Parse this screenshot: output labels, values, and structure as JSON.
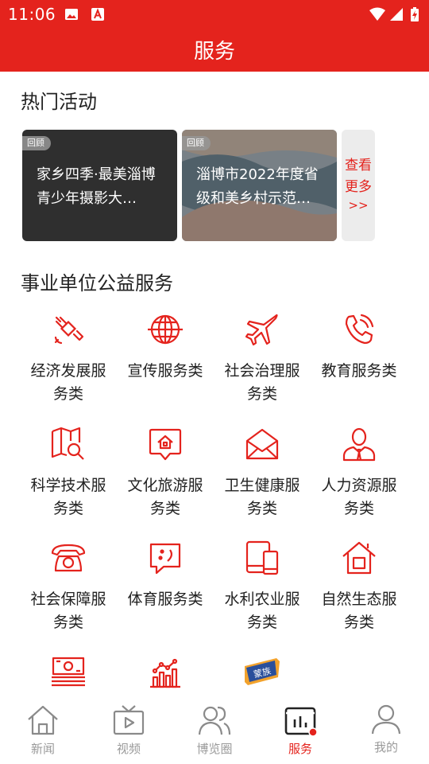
{
  "status_bar": {
    "time": "11:06",
    "icons": [
      "image-icon",
      "a-badge-icon",
      "wifi-icon",
      "signal-icon",
      "battery-icon"
    ]
  },
  "header": {
    "title": "服务"
  },
  "hot_activities": {
    "title": "热门活动",
    "cards": [
      {
        "badge": "回顾",
        "text": "家乡四季·最美淄博青少年摄影大…"
      },
      {
        "badge": "回顾",
        "text": "淄博市2022年度省级和美乡村示范…"
      }
    ],
    "more": {
      "line1": "查看",
      "line2": "更多",
      "line3": ">>"
    }
  },
  "public_services": {
    "title": "事业单位公益服务",
    "items": [
      {
        "label": "经济发展服务类",
        "icon": "satellite-icon"
      },
      {
        "label": "宣传服务类",
        "icon": "globe-icon"
      },
      {
        "label": "社会治理服务类",
        "icon": "airplane-icon"
      },
      {
        "label": "教育服务类",
        "icon": "phone-call-icon"
      },
      {
        "label": "科学技术服务类",
        "icon": "map-search-icon"
      },
      {
        "label": "文化旅游服务类",
        "icon": "home-bubble-icon"
      },
      {
        "label": "卫生健康服务类",
        "icon": "envelope-icon"
      },
      {
        "label": "人力资源服务类",
        "icon": "person-icon"
      },
      {
        "label": "社会保障服务类",
        "icon": "telephone-icon"
      },
      {
        "label": "体育服务类",
        "icon": "chat-bubble-icon"
      },
      {
        "label": "水利农业服务类",
        "icon": "devices-icon"
      },
      {
        "label": "自然生态服务类",
        "icon": "house-icon"
      },
      {
        "label": "",
        "icon": "money-stack-icon"
      },
      {
        "label": "",
        "icon": "bar-chart-icon"
      },
      {
        "label": "",
        "icon": "ribbon-tag-icon",
        "tag_text": "蒙族"
      }
    ]
  },
  "bottom_nav": {
    "tabs": [
      {
        "label": "新闻",
        "icon": "home-icon",
        "active": false
      },
      {
        "label": "视频",
        "icon": "tv-icon",
        "active": false
      },
      {
        "label": "博览圈",
        "icon": "people-icon",
        "active": false
      },
      {
        "label": "服务",
        "icon": "service-chart-icon",
        "active": true
      },
      {
        "label": "我的",
        "icon": "user-icon",
        "active": false
      }
    ]
  },
  "colors": {
    "brand_red": "#e4231d",
    "inactive_gray": "#9a9a9a",
    "text": "#222222"
  }
}
